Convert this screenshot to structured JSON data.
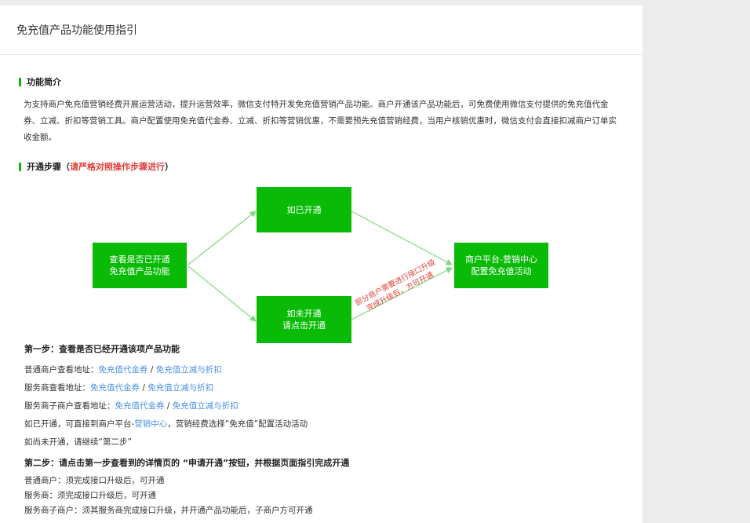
{
  "header": {
    "title": "免充值产品功能使用指引"
  },
  "section1": {
    "title": "功能简介",
    "paragraph": "为支持商户免充值营销经费开展运营活动，提升运营效率，微信支付特开发免充值营销产品功能。商户开通该产品功能后，可免费使用微信支付提供的免充值代金券、立减、折扣等营销工具。商户配置使用免充值代金券、立减、折扣等营销优惠，不需要预先充值营销经费，当用户核销优惠时，微信支付会直接扣减商户订单实收金额。"
  },
  "section2": {
    "title": "开通步骤（",
    "title_red": "请严格对照操作步骤进行",
    "title_end": "）"
  },
  "flow": {
    "start": "查看是否已开通\n免充值产品功能",
    "opened": "如已开通",
    "not_opened": "如未开通\n请点击开通",
    "end": "商户平台-营销中心\n配置免充值活动",
    "note": "部分商户需要进行接口升级\n完成升级后，方可开通",
    "colors": {
      "box": "#09bb07",
      "arrow": "#7fd97f",
      "note": "#e0403a"
    }
  },
  "step1": {
    "title": "第一步：查看是否已经开通该项产品功能",
    "rows": [
      {
        "label": "普通商户查看地址：",
        "link1": "免充值代金券",
        "sep": " / ",
        "link2": "免充值立减与折扣"
      },
      {
        "label": "服务商查看地址：",
        "link1": "免充值代金券",
        "sep": " / ",
        "link2": "免充值立减与折扣"
      },
      {
        "label": "服务商子商户查看地址：",
        "link1": "免充值代金券",
        "sep": " / ",
        "link2": "免充值立减与折扣"
      }
    ],
    "opened_prefix": "如已开通，可直接到商户平台-",
    "opened_link": "营销中心",
    "opened_suffix": "，营销经费选择“免充值”配置活动活动",
    "not_opened": "如尚未开通，请继续“第二步”"
  },
  "step2": {
    "title": "第二步：请点击第一步查看到的详情页的 “申请开通”按钮，并根据页面指引完成开通",
    "lines": [
      "普通商户：须完成接口升级后，可开通",
      "服务商：须完成接口升级后，可开通",
      "服务商子商户：须其服务商完成接口升级，并开通产品功能后，子商户方可开通"
    ]
  }
}
